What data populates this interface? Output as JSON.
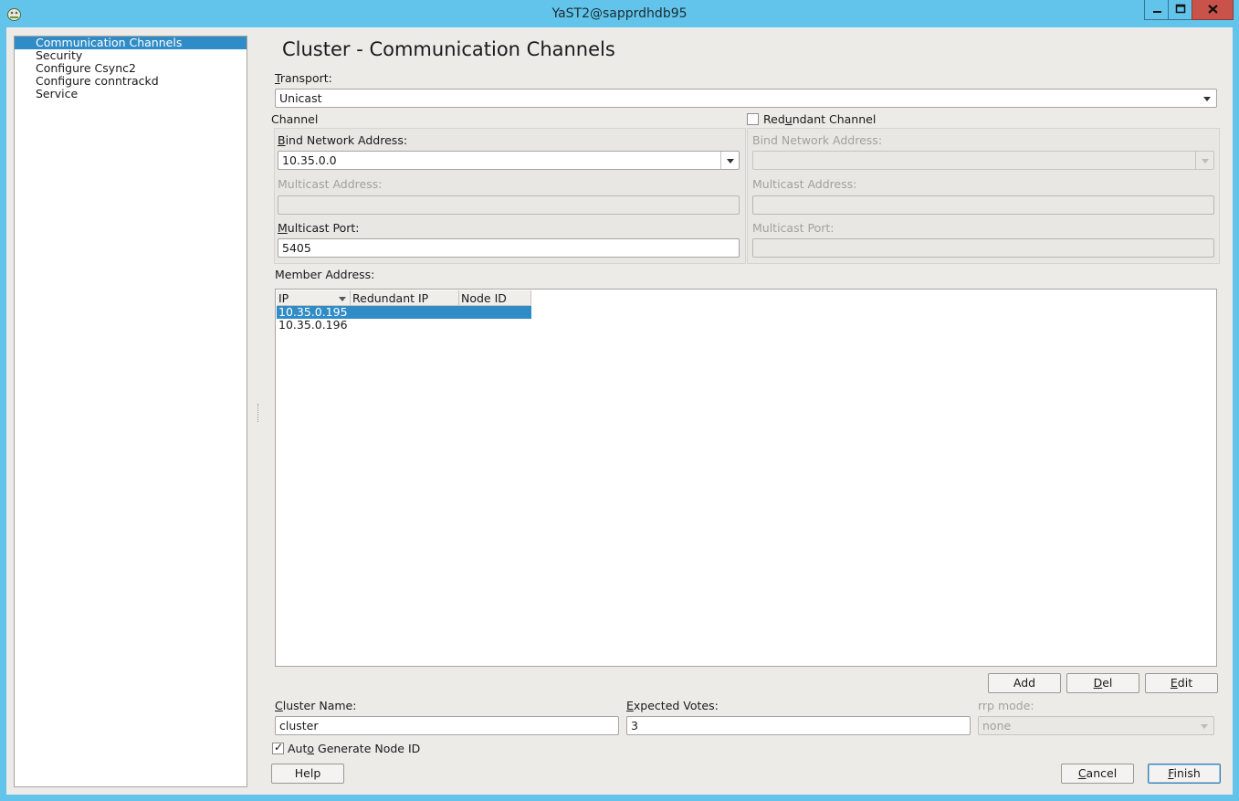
{
  "window": {
    "title": "YaST2@sapprdhdb95"
  },
  "sidebar": {
    "items": [
      {
        "label": "Communication Channels"
      },
      {
        "label": "Security"
      },
      {
        "label": "Configure Csync2"
      },
      {
        "label": "Configure conntrackd"
      },
      {
        "label": "Service"
      }
    ]
  },
  "main": {
    "heading": "Cluster - Communication Channels",
    "transport": {
      "label_prefix": "T",
      "label_rest": "ransport:",
      "value": "Unicast"
    },
    "channel": {
      "group_label": "Channel",
      "bind_label_prefix": "B",
      "bind_label_rest": "ind Network Address:",
      "bind_value": "10.35.0.0",
      "mcast_addr_label": "Multicast Address:",
      "mcast_addr_value": "",
      "mcast_port_label_prefix": "M",
      "mcast_port_label_rest": "ulticast Port:",
      "mcast_port_value": "5405"
    },
    "redundant": {
      "checkbox_label_a": "Red",
      "checkbox_label_u": "u",
      "checkbox_label_b": "ndant Channel",
      "checked": false,
      "bind_label": "Bind Network Address:",
      "mcast_addr_label": "Multicast Address:",
      "mcast_port_label": "Multicast Port:"
    },
    "members": {
      "label": "Member Address:",
      "columns": [
        "IP",
        "Redundant IP",
        "Node ID"
      ],
      "rows": [
        {
          "ip": "10.35.0.195",
          "redundant_ip": "",
          "node_id": ""
        },
        {
          "ip": "10.35.0.196",
          "redundant_ip": "",
          "node_id": ""
        }
      ],
      "add_label": "Add",
      "del_label_prefix": "D",
      "del_label_rest": "el",
      "edit_label_prefix": "E",
      "edit_label_rest": "dit"
    },
    "cluster_name": {
      "label_prefix": "C",
      "label_rest": "luster Name:",
      "value": "cluster"
    },
    "expected_votes": {
      "label_prefix": "E",
      "label_rest": "xpected Votes:",
      "value": "3"
    },
    "rrp_mode": {
      "label": "rrp mode:",
      "value": "none"
    },
    "auto_node_id": {
      "label_a": "Aut",
      "label_u": "o",
      "label_b": " Generate Node ID",
      "checked": true
    }
  },
  "footer": {
    "help_label": "Help",
    "cancel_label_prefix": "C",
    "cancel_label_rest": "ancel",
    "finish_label_prefix": "F",
    "finish_label_rest": "inish"
  },
  "colors": {
    "titlebar": "#62c4ea",
    "selection": "#308cc6",
    "close_button": "#c9534a",
    "dialog_bg": "#edebe8"
  }
}
